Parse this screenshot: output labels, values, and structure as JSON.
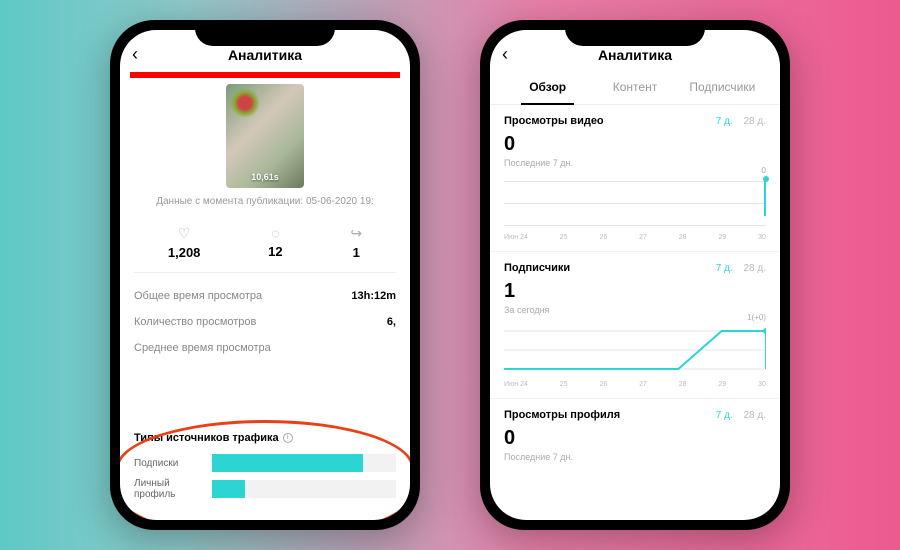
{
  "left": {
    "title": "Аналитика",
    "thumb_time": "10,61s",
    "pubdate": "Данные с момента публикации: 05-06-2020 19:",
    "stats": {
      "likes": "1,208",
      "comments": "12",
      "shares": "1"
    },
    "rows": {
      "watch_time_l": "Общее время просмотра",
      "watch_time_v": "13h:12m",
      "views_l": "Количество просмотров",
      "views_v": "6,",
      "avg_l": "Среднее время просмотра"
    },
    "traffic": {
      "title": "Типы источников трафика",
      "subs": "Подписки",
      "profile": "Личный профиль"
    }
  },
  "right": {
    "title": "Аналитика",
    "tabs": {
      "overview": "Обзор",
      "content": "Контент",
      "followers": "Подписчики"
    },
    "range7": "7 д.",
    "range28": "28 д.",
    "views": {
      "title": "Просмотры видео",
      "value": "0",
      "sub": "Последние 7 дн.",
      "marker": "0"
    },
    "followers": {
      "title": "Подписчики",
      "value": "1",
      "sub": "За сегодня",
      "marker": "1(+0)"
    },
    "profile": {
      "title": "Просмотры профиля",
      "value": "0",
      "sub": "Последние 7 дн."
    },
    "xaxis": [
      "Июн 24",
      "25",
      "26",
      "27",
      "28",
      "29",
      "30"
    ]
  },
  "chart_data": [
    {
      "type": "bar",
      "title": "Типы источников трафика",
      "categories": [
        "Подписки",
        "Личный профиль"
      ],
      "values": [
        82,
        18
      ],
      "ylim": [
        0,
        100
      ]
    },
    {
      "type": "line",
      "title": "Просмотры видео",
      "x": [
        "Июн 24",
        "25",
        "26",
        "27",
        "28",
        "29",
        "30"
      ],
      "values": [
        0,
        0,
        0,
        0,
        0,
        0,
        0
      ],
      "ylim": [
        0,
        1
      ]
    },
    {
      "type": "line",
      "title": "Подписчики",
      "x": [
        "Июн 24",
        "25",
        "26",
        "27",
        "28",
        "29",
        "30"
      ],
      "values": [
        0,
        0,
        0,
        0,
        0,
        1,
        1
      ],
      "ylim": [
        0,
        1
      ]
    }
  ]
}
